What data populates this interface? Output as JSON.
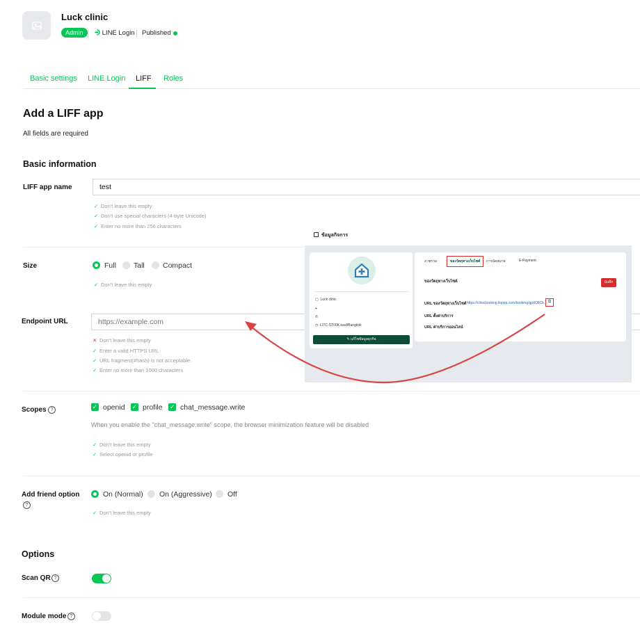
{
  "header": {
    "channel_name": "Luck clinic",
    "role_badge": "Admin",
    "channel_type": "LINE Login",
    "status": "Published"
  },
  "tabs": [
    "Basic settings",
    "LINE Login",
    "LIFF",
    "Roles"
  ],
  "page": {
    "title": "Add a LIFF app",
    "subtitle": "All fields are required",
    "section_basic": "Basic information",
    "section_options": "Options"
  },
  "liff_name": {
    "label": "LIFF app name",
    "value": "test",
    "rules": [
      "Don't leave this empty",
      "Don't use special characters (4-byte Unicode)",
      "Enter no more than 256 characters"
    ]
  },
  "size": {
    "label": "Size",
    "options": [
      "Full",
      "Tall",
      "Compact"
    ],
    "selected": "Full",
    "rules": [
      "Don't leave this empty"
    ]
  },
  "endpoint": {
    "label": "Endpoint URL",
    "placeholder": "https://example.com",
    "rules": [
      "Don't leave this empty",
      "Enter a valid HTTPS URL",
      "URL fragment(#hash) is not acceptable.",
      "Enter no more than 1000 characters"
    ]
  },
  "scopes": {
    "label": "Scopes",
    "options": [
      "openid",
      "profile",
      "chat_message.write"
    ],
    "note": "When you enable the \"chat_message.write\" scope, the browser minimization feature will be disabled",
    "rules": [
      "Don't leave this empty",
      "Select openid or profile"
    ]
  },
  "friend": {
    "label": "Add friend option",
    "options": [
      "On (Normal)",
      "On (Aggressive)",
      "Off"
    ],
    "selected": "On (Normal)",
    "rules": [
      "Don't leave this empty"
    ]
  },
  "options": {
    "scan_qr": {
      "label": "Scan QR",
      "on": true
    },
    "module_mode": {
      "label": "Module mode",
      "on": false
    }
  },
  "embedded": {
    "header_title": "ข้อมูลกิจการ",
    "tabs": [
      "ภาพรวม",
      "ของวัตถุทางเว็บไซต์",
      "การนัดหมาย",
      "E-Payment"
    ],
    "section_title": "ของวัตถุทางเว็บไซต์",
    "url_label": "URL ของวัตถุทางเว็บไซต์",
    "url_value": "https://clinicbooking.liqopp.com/booking/gpdO8Cb...",
    "row2": "URL ตั้งค่าบริการ",
    "row3": "URL ค่าบริการออนไลน์",
    "save_button": "บันทึก",
    "edit_button": "แก้ไขข้อมูลธุรกิจ",
    "profile_name": "Luck clinic",
    "hours": "LITC-ST00K.tusd/Bangkok"
  },
  "colors": {
    "accent": "#06c755",
    "error": "#e03838",
    "arrow": "#d94545",
    "dark_button": "#0e4d35"
  }
}
